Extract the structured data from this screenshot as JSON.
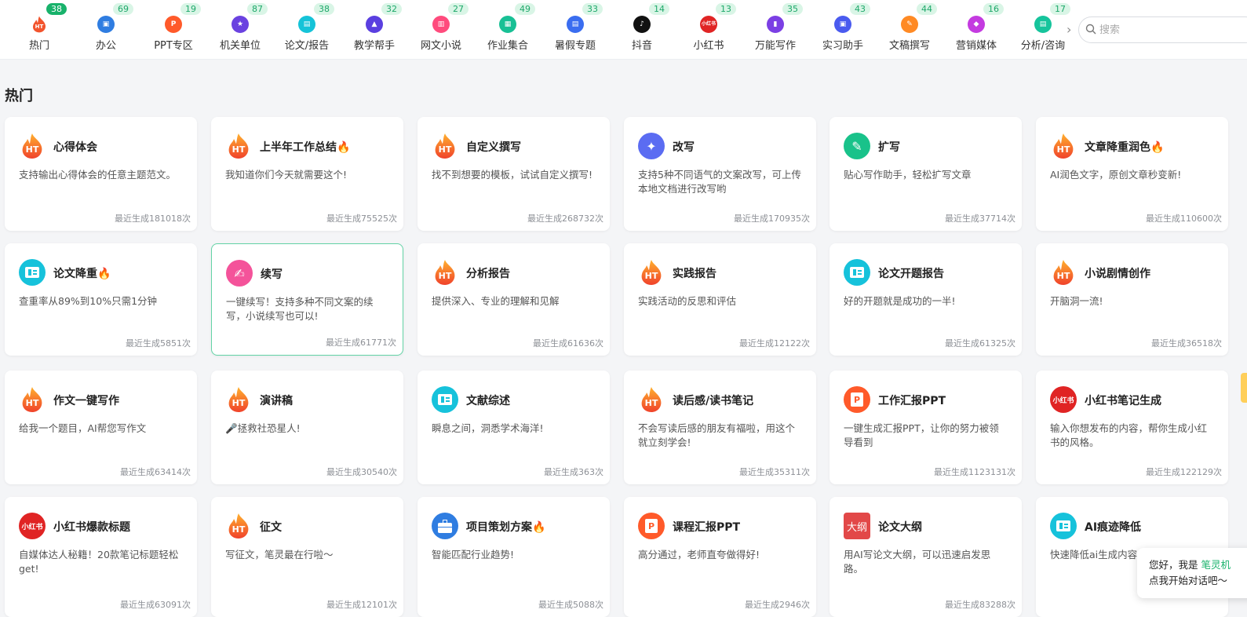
{
  "nav": {
    "categories": [
      {
        "label": "热门",
        "count": "38",
        "icon": "flame-ht-icon",
        "color": "#f0502b",
        "glyph": "HT",
        "active": true
      },
      {
        "label": "办公",
        "count": "69",
        "icon": "briefcase-icon",
        "color": "#2f7de1",
        "glyph": "▣"
      },
      {
        "label": "PPT专区",
        "count": "19",
        "icon": "ppt-icon",
        "color": "#ff5a2a",
        "glyph": "P"
      },
      {
        "label": "机关单位",
        "count": "87",
        "icon": "badge-icon",
        "color": "#6a42e0",
        "glyph": "★"
      },
      {
        "label": "论文/报告",
        "count": "38",
        "icon": "paper-icon",
        "color": "#15c3d8",
        "glyph": "▤"
      },
      {
        "label": "教学帮手",
        "count": "32",
        "icon": "graduation-cap-icon",
        "color": "#5a3fe0",
        "glyph": "▲"
      },
      {
        "label": "网文小说",
        "count": "27",
        "icon": "novel-icon",
        "color": "#ff4b7d",
        "glyph": "▥"
      },
      {
        "label": "作业集合",
        "count": "49",
        "icon": "homework-icon",
        "color": "#18c095",
        "glyph": "▦"
      },
      {
        "label": "暑假专题",
        "count": "33",
        "icon": "summer-icon",
        "color": "#3a6df0",
        "glyph": "▤"
      },
      {
        "label": "抖音",
        "count": "14",
        "icon": "douyin-icon",
        "color": "#111111",
        "glyph": "♪"
      },
      {
        "label": "小红书",
        "count": "13",
        "icon": "xiaohongshu-icon",
        "color": "#e02424",
        "glyph": "小红书"
      },
      {
        "label": "万能写作",
        "count": "35",
        "icon": "write-icon",
        "color": "#7b3fe4",
        "glyph": "▮"
      },
      {
        "label": "实习助手",
        "count": "43",
        "icon": "intern-icon",
        "color": "#4a5bef",
        "glyph": "▣"
      },
      {
        "label": "文稿撰写",
        "count": "44",
        "icon": "draft-icon",
        "color": "#ff8a24",
        "glyph": "✎"
      },
      {
        "label": "营销媒体",
        "count": "16",
        "icon": "tag-icon",
        "color": "#c43be0",
        "glyph": "◆"
      },
      {
        "label": "分析/咨询",
        "count": "17",
        "icon": "analysis-icon",
        "color": "#16c49c",
        "glyph": "▤"
      }
    ]
  },
  "search": {
    "placeholder": "搜索"
  },
  "section": {
    "title": "热门"
  },
  "cards": [
    {
      "title": "心得体会",
      "desc": "支持输出心得体会的任意主题范文。",
      "count": "最近生成181018次",
      "icon": "flame-ht-icon"
    },
    {
      "title": "上半年工作总结🔥",
      "desc": "我知道你们今天就需要这个!",
      "count": "最近生成75525次",
      "icon": "flame-ht-icon"
    },
    {
      "title": "自定义撰写",
      "desc": "找不到想要的模板，试试自定义撰写!",
      "count": "最近生成268732次",
      "icon": "flame-ht-icon"
    },
    {
      "title": "改写",
      "desc": "支持5种不同语气的文案改写，可上传本地文档进行改写哟",
      "count": "最近生成170935次",
      "icon": "rewrite-icon",
      "color": "#5b6cf2"
    },
    {
      "title": "扩写",
      "desc": "贴心写作助手，轻松扩写文章",
      "count": "最近生成37714次",
      "icon": "expand-icon",
      "color": "#19c28a"
    },
    {
      "title": "文章降重润色🔥",
      "desc": "AI润色文字，原创文章秒变新!",
      "count": "最近生成110600次",
      "icon": "flame-ht-icon"
    },
    {
      "title": "论文降重🔥",
      "desc": "查重率从89%到10%只需1分钟",
      "count": "最近生成5851次",
      "icon": "paper-card-icon",
      "color": "#16c2db"
    },
    {
      "title": "续写",
      "desc": "一键续写！支持多种不同文案的续写，小说续写也可以!",
      "count": "最近生成61771次",
      "icon": "continue-write-icon",
      "color": "#f4539a",
      "active": true
    },
    {
      "title": "分析报告",
      "desc": "提供深入、专业的理解和见解",
      "count": "最近生成61636次",
      "icon": "flame-ht-icon"
    },
    {
      "title": "实践报告",
      "desc": "实践活动的反思和评估",
      "count": "最近生成12122次",
      "icon": "flame-ht-icon"
    },
    {
      "title": "论文开题报告",
      "desc": "好的开题就是成功的一半!",
      "count": "最近生成61325次",
      "icon": "paper-card-icon",
      "color": "#16c2db"
    },
    {
      "title": "小说剧情创作",
      "desc": "开脑洞一流!",
      "count": "最近生成36518次",
      "icon": "flame-ht-icon"
    },
    {
      "title": "作文一键写作",
      "desc": "给我一个题目，AI帮您写作文",
      "count": "最近生成63414次",
      "icon": "flame-ht-icon"
    },
    {
      "title": "演讲稿",
      "desc": "🎤拯救社恐星人!",
      "count": "最近生成30540次",
      "icon": "flame-ht-icon"
    },
    {
      "title": "文献综述",
      "desc": "瞬息之间，洞悉学术海洋!",
      "count": "最近生成363次",
      "icon": "paper-card-icon",
      "color": "#16c2db"
    },
    {
      "title": "读后感/读书笔记",
      "desc": "不会写读后感的朋友有福啦，用这个就立刻学会!",
      "count": "最近生成35311次",
      "icon": "flame-ht-icon"
    },
    {
      "title": "工作汇报PPT",
      "desc": "一键生成汇报PPT，让你的努力被领导看到",
      "count": "最近生成1123131次",
      "icon": "ppt-icon",
      "color": "#ff5a2a"
    },
    {
      "title": "小红书笔记生成",
      "desc": "输入你想发布的内容，帮你生成小红书的风格。",
      "count": "最近生成122129次",
      "icon": "xiaohongshu-icon",
      "color": "#e02424"
    },
    {
      "title": "小红书爆款标题",
      "desc": "自媒体达人秘籍！20款笔记标题轻松get!",
      "count": "最近生成63091次",
      "icon": "xiaohongshu-icon",
      "color": "#e02424"
    },
    {
      "title": "征文",
      "desc": "写征文，笔灵最在行啦～",
      "count": "最近生成12101次",
      "icon": "flame-ht-icon"
    },
    {
      "title": "项目策划方案🔥",
      "desc": "智能匹配行业趋势!",
      "count": "最近生成5088次",
      "icon": "briefcase-icon",
      "color": "#2f7de1"
    },
    {
      "title": "课程汇报PPT",
      "desc": "高分通过，老师直夸做得好!",
      "count": "最近生成2946次",
      "icon": "ppt-icon",
      "color": "#ff5a2a"
    },
    {
      "title": "论文大纲",
      "desc": "用AI写论文大纲，可以迅速启发思路。",
      "count": "最近生成83288次",
      "icon": "outline-icon",
      "color": "#e24848",
      "glyph": "大纲"
    },
    {
      "title": "AI痕迹降低",
      "desc": "快速降低ai生成内容",
      "count": "",
      "icon": "paper-card-icon",
      "color": "#16c2db"
    }
  ],
  "chat": {
    "line1_prefix": "您好，我是 ",
    "line1_name": "笔灵机",
    "line2": "点我开始对话吧～"
  },
  "colors": {
    "accent": "#18b26b",
    "flame_top": "#ffb02e",
    "flame_bottom": "#f0422b"
  }
}
